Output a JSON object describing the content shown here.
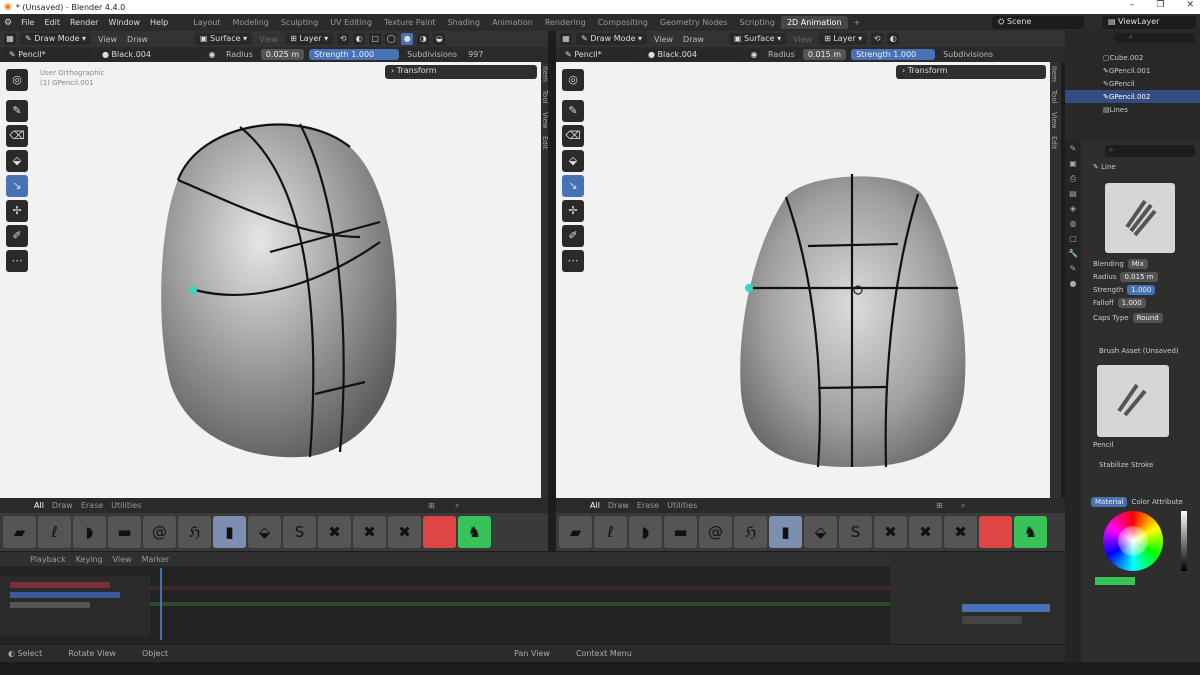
{
  "window": {
    "title": "* (Unsaved) - Blender 4.4.0",
    "controls": [
      "–",
      "❐",
      "✕"
    ]
  },
  "menu": [
    "File",
    "Edit",
    "Render",
    "Window",
    "Help"
  ],
  "workspaces": [
    "Layout",
    "Modeling",
    "Sculpting",
    "UV Editing",
    "Texture Paint",
    "Shading",
    "Animation",
    "Rendering",
    "Compositing",
    "Geometry Nodes",
    "Scripting",
    "2D Animation",
    "+"
  ],
  "active_workspace": "2D Animation",
  "scene": "Scene",
  "view_layer": "ViewLayer",
  "left_header": {
    "mode": "Draw Mode",
    "view": "View",
    "draw": "Draw",
    "placement": "Surface",
    "view2": "View",
    "layer": "Layer"
  },
  "left_tool": {
    "brush": "Pencil*",
    "material": "Black.004",
    "radius_label": "Radius",
    "radius_value": "0.025 m",
    "strength_label": "Strength",
    "strength_value": "1.000",
    "subdiv_label": "Subdivisions",
    "subdiv_value": "997"
  },
  "right_header": {
    "mode": "Draw Mode",
    "view": "View",
    "draw": "Draw",
    "placement": "Surface",
    "view2": "View",
    "layer": "Layer"
  },
  "right_tool": {
    "brush": "Pencil*",
    "material": "Black.004",
    "radius_label": "Radius",
    "radius_value": "0.015 m",
    "strength_label": "Strength",
    "strength_value": "1.000",
    "subdiv_label": "Subdivisions"
  },
  "left_view": {
    "overlay_line1": "User Orthographic",
    "overlay_line2": "(1) GPencil.001",
    "panel": "Transform"
  },
  "right_view": {
    "panel": "Transform"
  },
  "side_tabs": [
    "Item",
    "Tool",
    "View",
    "Edit"
  ],
  "asset_tabs": [
    "All",
    "Draw",
    "Erase",
    "Utilities"
  ],
  "outliner": [
    "Cube.002",
    "GPencil.001",
    "GPencil",
    "GPencil.002",
    "Lines"
  ],
  "properties": {
    "brush_name": "Line",
    "blend_label": "Blending",
    "blend_value": "Mix",
    "radius_label": "Radius",
    "radius_value": "0.015 m",
    "strength_label": "Strength",
    "strength_value": "1.000",
    "falloff_label": "Falloff",
    "falloff_value": "1.000",
    "caps_label": "Caps Type",
    "caps_value": "Round",
    "brush_asset_label": "Brush Asset (Unsaved)",
    "brush_preview_label": "Pencil",
    "stabilizer_label": "Stabilize Stroke",
    "color_mode_label": "Material",
    "color_mode_alt": "Color Attribute"
  },
  "timeline_header": [
    "Playback",
    "Keying",
    "View",
    "Marker"
  ],
  "status": [
    "Select",
    "Rotate View",
    "Object",
    "Pan View",
    "Context Menu"
  ],
  "colors": {
    "accent": "#4772b3",
    "viewport_bg": "#f2f2f2",
    "panel_bg": "#2e2e2e"
  }
}
